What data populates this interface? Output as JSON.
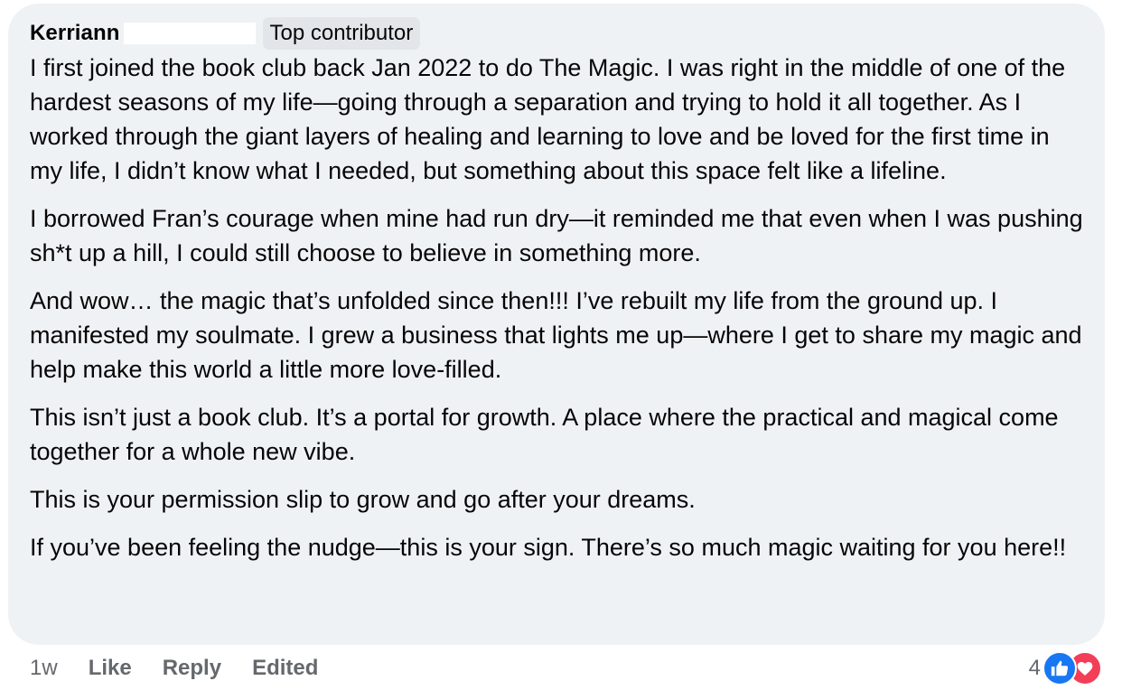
{
  "comment": {
    "author": "Kerriann",
    "badge": "Top contributor",
    "paragraphs": [
      "I first joined the book club back Jan 2022 to do The Magic. I was right in the middle of one of the hardest seasons of my life—going through a separation and trying to hold it all together. As I worked through the giant layers of healing and learning to love and be loved for the first time in my life, I didn’t know what I needed, but something about this space felt like a lifeline.",
      "I borrowed Fran’s courage when mine had run dry—it reminded me that even when I was pushing sh*t up a hill, I could still choose to believe in something more.",
      "And wow… the magic that’s unfolded since then!!! I’ve rebuilt my life from the ground up. I manifested my soulmate. I grew a business that lights me up—where I get to share my magic and help make this world a little more love-filled.",
      "This isn’t just a book club. It’s a portal for growth. A place where the practical and magical come together for a whole new vibe.",
      "This is your permission slip to grow and go after your dreams.",
      "If you’ve been feeling the nudge—this is your sign. There’s so much magic waiting for you here!!"
    ]
  },
  "footer": {
    "time": "1w",
    "like_label": "Like",
    "reply_label": "Reply",
    "edited_label": "Edited"
  },
  "reactions": {
    "count": "4",
    "icons": [
      "like-icon",
      "love-icon"
    ],
    "like_color": "#1877f2",
    "love_color": "#f33e58"
  },
  "colors": {
    "bubble_bg": "#eff2f5",
    "badge_bg": "#e2e5e9",
    "muted_text": "#65686c"
  }
}
